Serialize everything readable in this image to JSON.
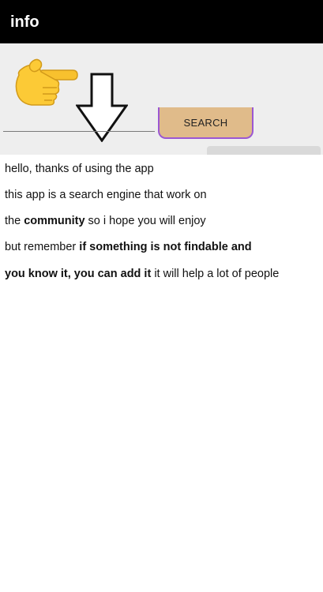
{
  "appbar": {
    "title": "info"
  },
  "search": {
    "placeholder": "",
    "button_label": "SEARCH"
  },
  "icons": {
    "hand": "backhand-index-pointing-right-icon",
    "arrow": "down-arrow-outline-icon"
  },
  "colors": {
    "appbar": "#000000",
    "header_bg": "#eeeeee",
    "button_fill": "#e0bb8a",
    "button_border": "#9b57d3"
  },
  "message": {
    "line1": "hello, thanks of using the app",
    "line2": "this app is a search engine that work on",
    "line3_a": "the ",
    "line3_b": "community",
    "line3_c": " so i hope you will enjoy",
    "line4_a": "but remember ",
    "line4_b": "if something is not findable and",
    "line5_a": "you know it, you can add it",
    "line5_b": " it will help a lot of people"
  }
}
